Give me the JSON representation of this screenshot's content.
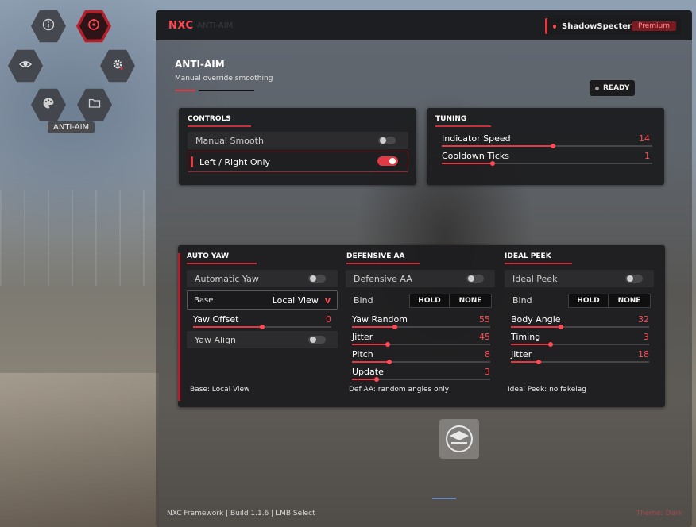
{
  "nav": {
    "active_label": "ANTI-AIM",
    "items": [
      {
        "icon": "info-icon"
      },
      {
        "icon": "crosshair-icon",
        "active": true
      },
      {
        "icon": "eye-icon"
      },
      {
        "icon": "gear-icon"
      },
      {
        "icon": "palette-icon"
      },
      {
        "icon": "folder-icon"
      }
    ]
  },
  "header": {
    "brand": "NXC",
    "brand_sub": "ANTI-AIM",
    "username": "ShadowSpecter",
    "badge": "Premium"
  },
  "page": {
    "title": "ANTI-AIM",
    "subtitle": "Manual override smoothing",
    "status": "READY"
  },
  "controls": {
    "title": "CONTROLS",
    "items": [
      {
        "label": "Manual Smooth",
        "on": false
      },
      {
        "label": "Left / Right Only",
        "on": true
      }
    ]
  },
  "tuning": {
    "title": "TUNING",
    "sliders": [
      {
        "label": "Indicator Speed",
        "value": "14",
        "fraction": 0.53
      },
      {
        "label": "Cooldown Ticks",
        "value": "1",
        "fraction": 0.24
      }
    ]
  },
  "auto_yaw": {
    "title": "AUTO YAW",
    "toggle_label": "Automatic Yaw",
    "toggle_on": false,
    "select_label": "Base",
    "select_value": "Local View",
    "select_chevron": "v",
    "slider": {
      "label": "Yaw Offset",
      "value": "0",
      "fraction": 0.5
    },
    "align_label": "Yaw Align",
    "align_on": false,
    "footnote": "Base: Local View"
  },
  "defensive": {
    "title": "DEFENSIVE AA",
    "toggle_label": "Defensive AA",
    "toggle_on": false,
    "bind_label": "Bind",
    "bind_options": [
      "HOLD",
      "NONE"
    ],
    "sliders": [
      {
        "label": "Yaw Random",
        "value": "55",
        "fraction": 0.31
      },
      {
        "label": "Jitter",
        "value": "45",
        "fraction": 0.26
      },
      {
        "label": "Pitch",
        "value": "8",
        "fraction": 0.27
      },
      {
        "label": "Update",
        "value": "3",
        "fraction": 0.18
      }
    ],
    "footnote": "Def AA: random angles only"
  },
  "ideal_peek": {
    "title": "IDEAL PEEK",
    "toggle_label": "Ideal Peek",
    "toggle_on": false,
    "bind_label": "Bind",
    "bind_options": [
      "HOLD",
      "NONE"
    ],
    "sliders": [
      {
        "label": "Body Angle",
        "value": "32",
        "fraction": 0.36
      },
      {
        "label": "Timing",
        "value": "3",
        "fraction": 0.29
      },
      {
        "label": "Jitter",
        "value": "18",
        "fraction": 0.2
      }
    ],
    "footnote": "Ideal Peek: no fakelag"
  },
  "statusbar": {
    "text": "NXC Framework | Build 1.1.6 | LMB Select",
    "right": "Theme: Dark"
  },
  "colors": {
    "accent": "#e23a45",
    "panel": "#1c1c1e",
    "value_text": "#ff4a55"
  }
}
